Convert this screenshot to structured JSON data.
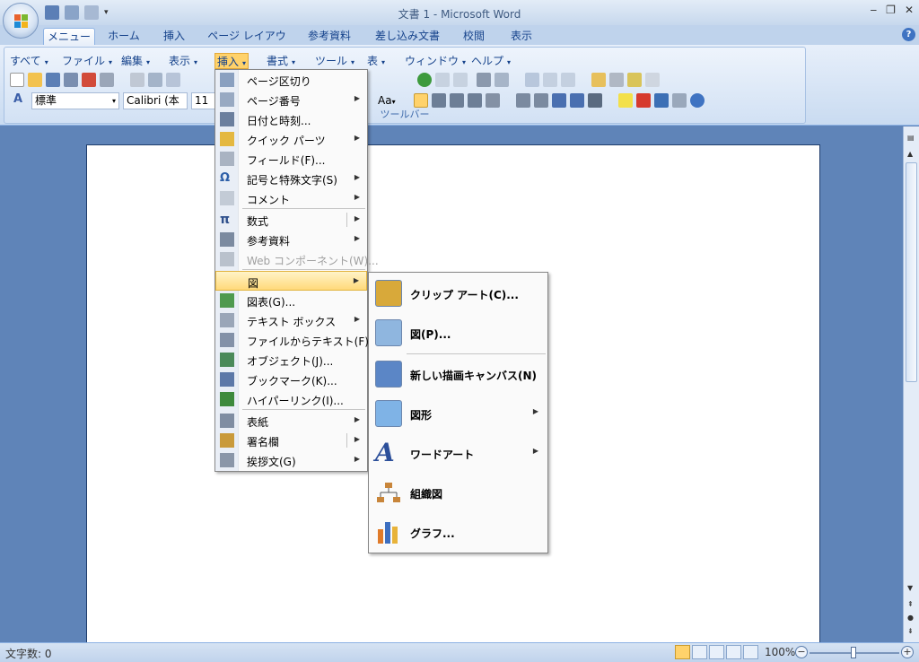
{
  "window": {
    "title": "文書 1 - Microsoft Word",
    "min": "‒",
    "max": "❐",
    "close": "✕"
  },
  "ribbon_tabs": [
    "メニュー",
    "ホーム",
    "挿入",
    "ページ レイアウト",
    "参考資料",
    "差し込み文書",
    "校閲",
    "表示"
  ],
  "menubar": {
    "items": [
      "すべて",
      "ファイル",
      "編集",
      "表示",
      "挿入",
      "書式",
      "ツール",
      "表",
      "ウィンドウ",
      "ヘルプ"
    ]
  },
  "toolbar": {
    "style_value": "標準",
    "font_value": "Calibri (本文",
    "size_value": "11",
    "group_label": "ツールバー",
    "font_case": "Aa"
  },
  "insert_menu": [
    {
      "label": "ページ区切り",
      "submenu": false
    },
    {
      "label": "ページ番号",
      "submenu": true
    },
    {
      "label": "日付と時刻...",
      "submenu": false
    },
    {
      "label": "クイック パーツ",
      "submenu": true
    },
    {
      "label": "フィールド(F)...",
      "submenu": false
    },
    {
      "label": "記号と特殊文字(S)",
      "submenu": true
    },
    {
      "label": "コメント",
      "submenu": true
    },
    {
      "label": "数式",
      "submenu": true
    },
    {
      "label": "参考資料",
      "submenu": true
    },
    {
      "label": "Web コンポーネント(W)...",
      "submenu": false,
      "disabled": true
    },
    {
      "label": "図",
      "submenu": true,
      "highlighted": true
    },
    {
      "label": "図表(G)...",
      "submenu": false
    },
    {
      "label": "テキスト ボックス",
      "submenu": true
    },
    {
      "label": "ファイルからテキスト(F)...",
      "submenu": false
    },
    {
      "label": "オブジェクト(J)...",
      "submenu": false
    },
    {
      "label": "ブックマーク(K)...",
      "submenu": false
    },
    {
      "label": "ハイパーリンク(I)...",
      "submenu": false
    },
    {
      "label": "表紙",
      "submenu": true
    },
    {
      "label": "署名欄",
      "submenu": true
    },
    {
      "label": "挨拶文(G)",
      "submenu": true
    }
  ],
  "picture_menu": [
    {
      "label": "クリップ アート(C)...",
      "submenu": false
    },
    {
      "label": "図(P)...",
      "submenu": false
    },
    {
      "label": "新しい描画キャンバス(N)",
      "submenu": false
    },
    {
      "label": "図形",
      "submenu": true
    },
    {
      "label": "ワードアート",
      "submenu": true
    },
    {
      "label": "組織図",
      "submenu": false
    },
    {
      "label": "グラフ...",
      "submenu": false
    }
  ],
  "status": {
    "word_count": "文字数: 0",
    "zoom": "100%"
  },
  "colors": {
    "ribbon": "#c9dbf1",
    "accent": "#15428b",
    "highlight": "#ffd97a",
    "doc_bg": "#5f84b8"
  }
}
